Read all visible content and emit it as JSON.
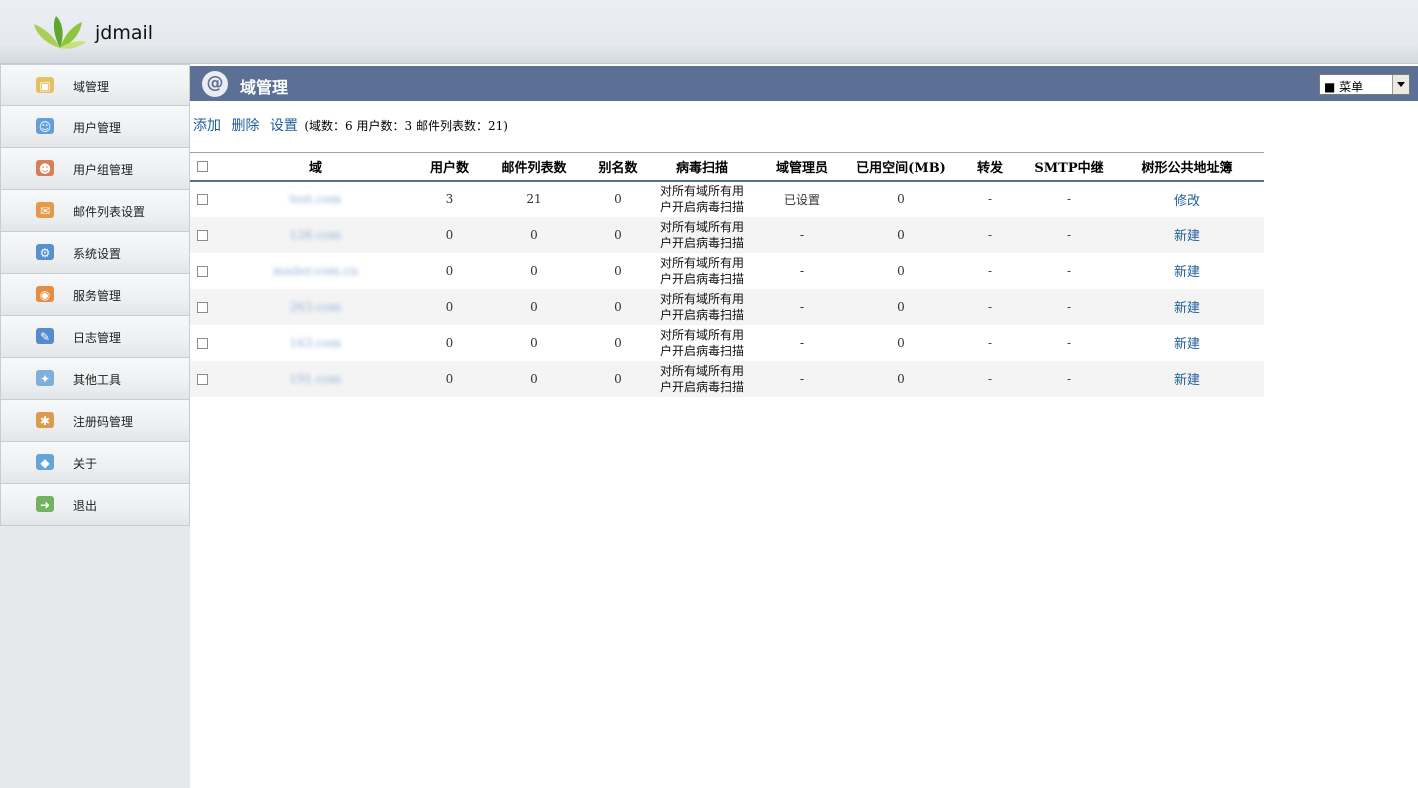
{
  "app": {
    "brand": "jdmail"
  },
  "sidebar": {
    "items": [
      {
        "label": "域管理",
        "icon": "domain-icon"
      },
      {
        "label": "用户管理",
        "icon": "user-icon"
      },
      {
        "label": "用户组管理",
        "icon": "group-icon"
      },
      {
        "label": "邮件列表设置",
        "icon": "mail-list-icon"
      },
      {
        "label": "系统设置",
        "icon": "system-icon"
      },
      {
        "label": "服务管理",
        "icon": "service-icon"
      },
      {
        "label": "日志管理",
        "icon": "log-icon"
      },
      {
        "label": "其他工具",
        "icon": "tools-icon"
      },
      {
        "label": "注册码管理",
        "icon": "license-icon"
      },
      {
        "label": "关于",
        "icon": "about-icon"
      },
      {
        "label": "退出",
        "icon": "logout-icon"
      }
    ]
  },
  "titlebar": {
    "title": "域管理",
    "menu_value": "■ 菜单"
  },
  "actions": {
    "add": "添加",
    "delete": "删除",
    "settings": "设置",
    "stats": "(域数：6  用户数：3  邮件列表数：21)"
  },
  "table": {
    "headers": [
      "域",
      "用户数",
      "邮件列表数",
      "别名数",
      "病毒扫描",
      "域管理员",
      "已用空间(MB)",
      "转发",
      "SMTP中继",
      "树形公共地址簿"
    ],
    "rows": [
      {
        "domain": "test.com",
        "users": "3",
        "lists": "21",
        "aliases": "0",
        "scan": "对所有域所有用户开启病毒扫描",
        "admin": "已设置",
        "space": "0",
        "forward": "-",
        "smtp": "-",
        "book": "修改"
      },
      {
        "domain": "126.com",
        "users": "0",
        "lists": "0",
        "aliases": "0",
        "scan": "对所有域所有用户开启病毒扫描",
        "admin": "-",
        "space": "0",
        "forward": "-",
        "smtp": "-",
        "book": "新建"
      },
      {
        "domain": "mailer.com.cn",
        "users": "0",
        "lists": "0",
        "aliases": "0",
        "scan": "对所有域所有用户开启病毒扫描",
        "admin": "-",
        "space": "0",
        "forward": "-",
        "smtp": "-",
        "book": "新建"
      },
      {
        "domain": "263.com",
        "users": "0",
        "lists": "0",
        "aliases": "0",
        "scan": "对所有域所有用户开启病毒扫描",
        "admin": "-",
        "space": "0",
        "forward": "-",
        "smtp": "-",
        "book": "新建"
      },
      {
        "domain": "163.com",
        "users": "0",
        "lists": "0",
        "aliases": "0",
        "scan": "对所有域所有用户开启病毒扫描",
        "admin": "-",
        "space": "0",
        "forward": "-",
        "smtp": "-",
        "book": "新建"
      },
      {
        "domain": "191.com",
        "users": "0",
        "lists": "0",
        "aliases": "0",
        "scan": "对所有域所有用户开启病毒扫描",
        "admin": "-",
        "space": "0",
        "forward": "-",
        "smtp": "-",
        "book": "新建"
      }
    ]
  },
  "colors": {
    "titlebar": "#5b7094",
    "link": "#1f5c9e"
  }
}
